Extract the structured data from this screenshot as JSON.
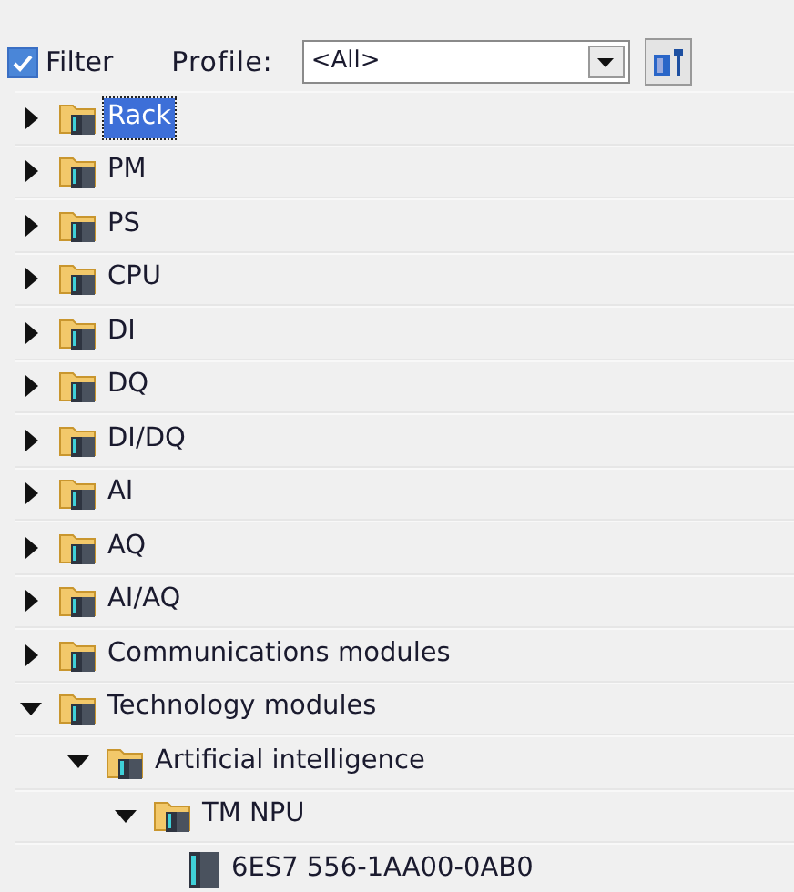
{
  "toolbar": {
    "filter": {
      "label": "Filter",
      "checked": true
    },
    "profile_label": "Profile:",
    "profile": {
      "value": "<All>"
    }
  },
  "tree": [
    {
      "label": "Rack",
      "expanded": false,
      "selected": true
    },
    {
      "label": "PM",
      "expanded": false,
      "selected": false
    },
    {
      "label": "PS",
      "expanded": false,
      "selected": false
    },
    {
      "label": "CPU",
      "expanded": false,
      "selected": false
    },
    {
      "label": "DI",
      "expanded": false,
      "selected": false
    },
    {
      "label": "DQ",
      "expanded": false,
      "selected": false
    },
    {
      "label": "DI/DQ",
      "expanded": false,
      "selected": false
    },
    {
      "label": "AI",
      "expanded": false,
      "selected": false
    },
    {
      "label": "AQ",
      "expanded": false,
      "selected": false
    },
    {
      "label": "AI/AQ",
      "expanded": false,
      "selected": false
    },
    {
      "label": "Communications modules",
      "expanded": false,
      "selected": false
    },
    {
      "label": "Technology modules",
      "expanded": true,
      "selected": false,
      "children": [
        {
          "label": "Artificial intelligence",
          "expanded": true,
          "selected": false,
          "children": [
            {
              "label": "TM NPU",
              "expanded": true,
              "selected": false,
              "children": [
                {
                  "label": "6ES7 556-1AA00-0AB0",
                  "kind": "module",
                  "selected": false
                }
              ]
            }
          ]
        }
      ]
    }
  ]
}
